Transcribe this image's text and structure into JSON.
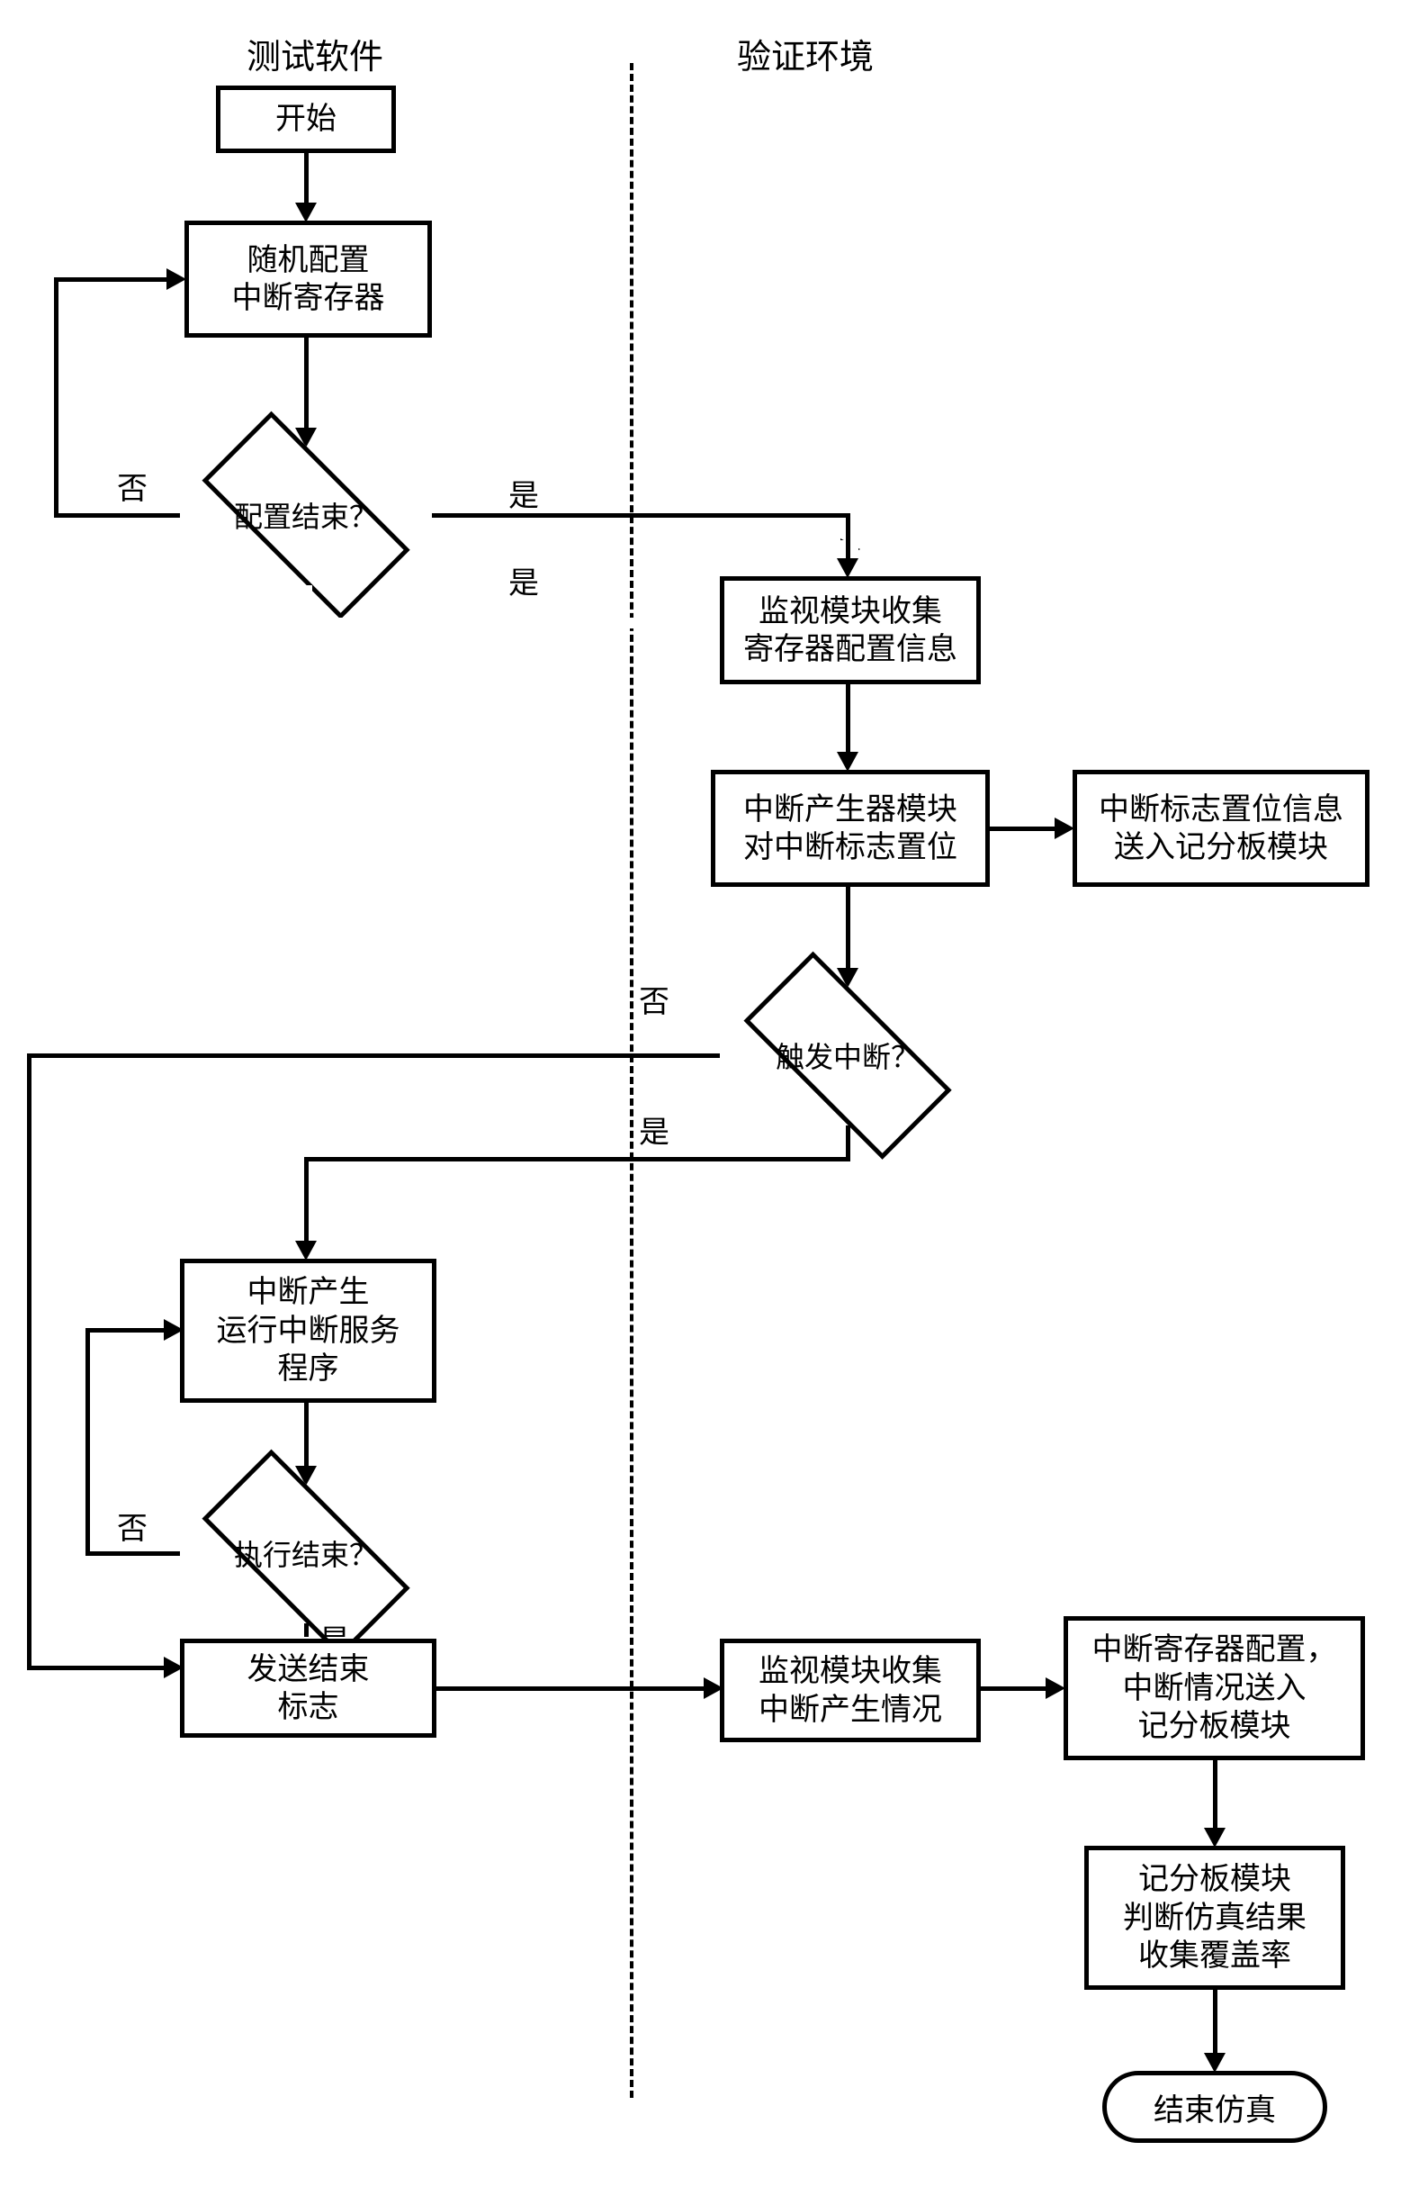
{
  "headers": {
    "left": "测试软件",
    "right": "验证环境"
  },
  "nodes": {
    "start": "开始",
    "configure": "随机配置\n中断寄存器",
    "config_done": "配置结束？",
    "monitor1": "监视模块收集\n寄存器配置信息",
    "generator": "中断产生器模块\n对中断标志置位",
    "flag_set": "中断标志置位信息\n送入记分板模块",
    "trigger": "触发中断？",
    "isr": "中断产生\n运行中断服务\n程序",
    "exec_done": "执行结束？",
    "send_end": "发送结束\n标志",
    "monitor2": "监视模块收集\n中断产生情况",
    "reg_config": "中断寄存器配置，\n中断情况送入\n记分板模块",
    "scoreboard": "记分板模块\n判断仿真结果\n收集覆盖率",
    "end": "结束仿真"
  },
  "labels": {
    "yes": "是",
    "no": "否"
  }
}
